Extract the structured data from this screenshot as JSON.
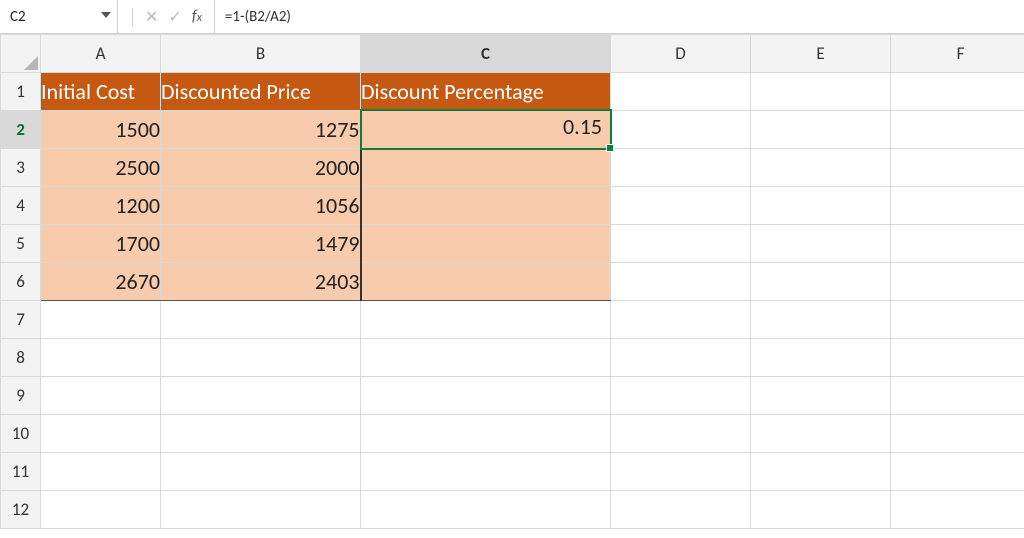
{
  "name_box": {
    "value": "C2"
  },
  "formula_bar": {
    "formula": "=1-(B2/A2)"
  },
  "column_headers": [
    "A",
    "B",
    "C",
    "D",
    "E",
    "F"
  ],
  "row_headers": [
    "1",
    "2",
    "3",
    "4",
    "5",
    "6",
    "7",
    "8",
    "9",
    "10",
    "11",
    "12"
  ],
  "active": {
    "col": "C",
    "row": "2"
  },
  "table": {
    "headers": {
      "A": "Initial Cost",
      "B": "Discounted Price",
      "C": "Discount Percentage"
    },
    "rows": [
      {
        "A": "1500",
        "B": "1275",
        "C": "0.15"
      },
      {
        "A": "2500",
        "B": "2000",
        "C": ""
      },
      {
        "A": "1200",
        "B": "1056",
        "C": ""
      },
      {
        "A": "1700",
        "B": "1479",
        "C": ""
      },
      {
        "A": "2670",
        "B": "2403",
        "C": ""
      }
    ]
  }
}
